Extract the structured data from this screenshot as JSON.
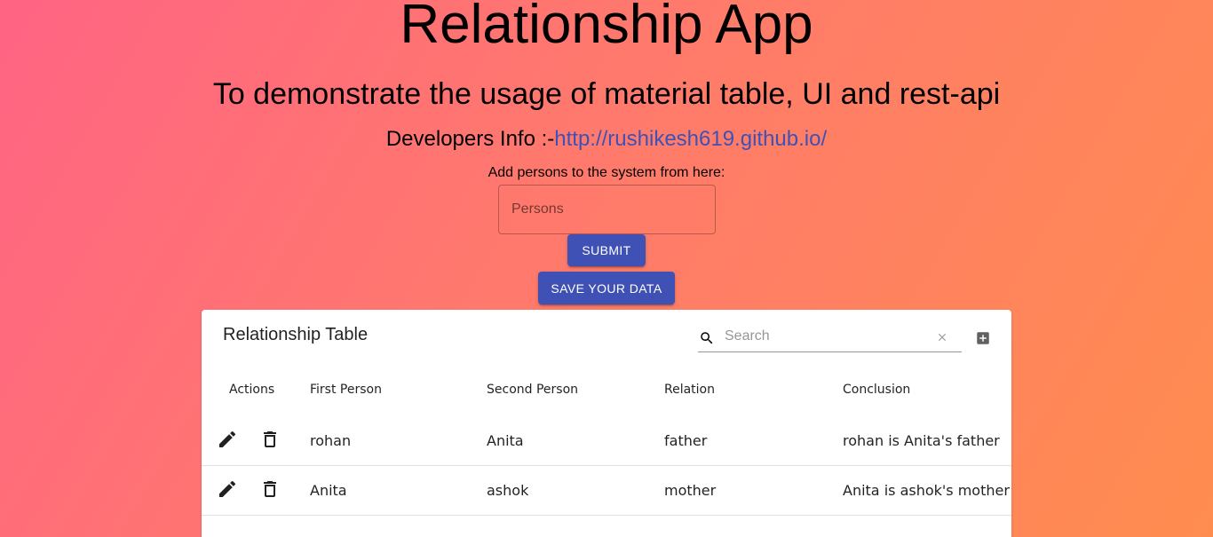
{
  "header": {
    "title": "Relationship App",
    "subtitle": "To demonstrate the usage of material table, UI and rest-api",
    "dev_prefix": "Developers Info :-",
    "dev_link": "http://rushikesh619.github.io/"
  },
  "form": {
    "label": "Add persons to the system from here:",
    "persons_placeholder": "Persons",
    "submit_label": "SUBMIT",
    "save_label": "SAVE YOUR DATA"
  },
  "table": {
    "title": "Relationship Table",
    "search_placeholder": "Search",
    "columns": [
      "Actions",
      "First Person",
      "Second Person",
      "Relation",
      "Conclusion"
    ],
    "rows": [
      {
        "first": "rohan",
        "second": "Anita",
        "relation": "father",
        "conclusion": "rohan is Anita's father"
      },
      {
        "first": "Anita",
        "second": "ashok",
        "relation": "mother",
        "conclusion": "Anita is ashok's mother"
      }
    ]
  },
  "colors": {
    "primary": "#3f51b5",
    "gradient_start": "#ff6483",
    "gradient_end": "#ff8c4f"
  },
  "icons": [
    "edit-icon",
    "delete-icon",
    "search-icon",
    "clear-icon",
    "add-box-icon"
  ]
}
